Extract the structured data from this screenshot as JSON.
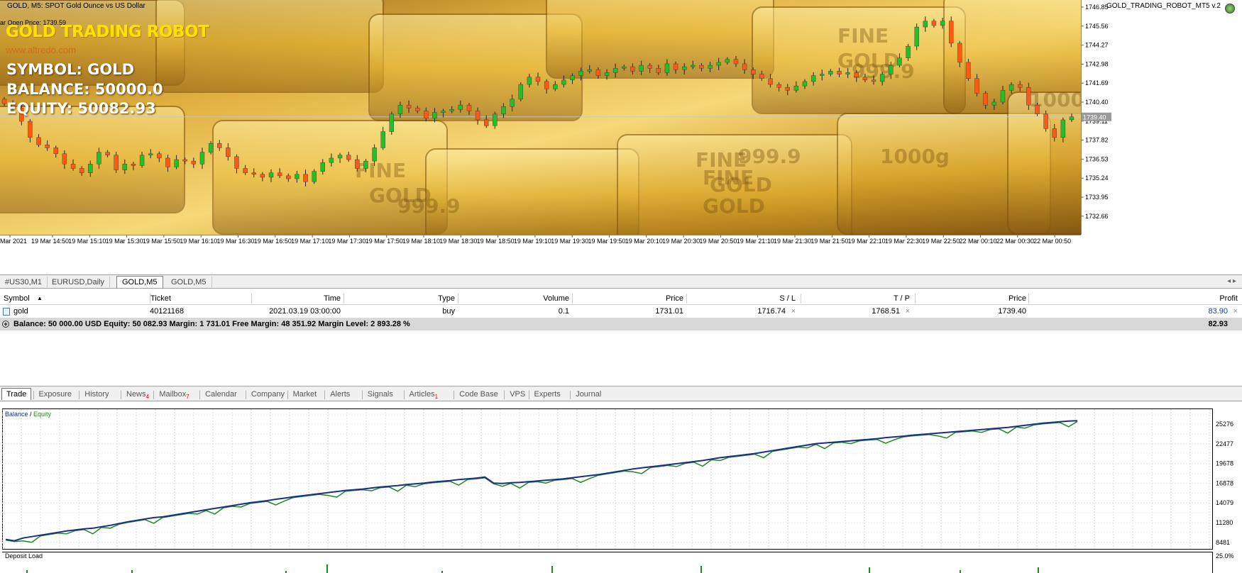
{
  "chart": {
    "title": "GOLD, M5:  SPOT Gold Ounce vs US Dollar",
    "open_price": "ar Open Price:  1739.59",
    "robot_name": "GOLD TRADING ROBOT",
    "website": "www.altredo.com",
    "symbol_line": "SYMBOL: GOLD",
    "balance_line": "BALANCE: 50000.0",
    "equity_line": "EQUITY: 50082.93",
    "ea_label": "GOLD_TRADING_ROBOT_MT5  v.2",
    "current_price": "1739.40",
    "price_ticks": [
      "1746.85",
      "1745.56",
      "1744.27",
      "1742.98",
      "1741.69",
      "1740.40",
      "1739.11",
      "1737.82",
      "1736.53",
      "1735.24",
      "1733.95",
      "1732.66"
    ],
    "time_ticks": [
      "Mar 2021",
      "19 Mar 14:50",
      "19 Mar 15:10",
      "19 Mar 15:30",
      "19 Mar 15:50",
      "19 Mar 16:10",
      "19 Mar 16:30",
      "19 Mar 16:50",
      "19 Mar 17:10",
      "19 Mar 17:30",
      "19 Mar 17:50",
      "19 Mar 18:10",
      "19 Mar 18:30",
      "19 Mar 18:50",
      "19 Mar 19:10",
      "19 Mar 19:30",
      "19 Mar 19:50",
      "19 Mar 20:10",
      "19 Mar 20:30",
      "19 Mar 20:50",
      "19 Mar 21:10",
      "19 Mar 21:30",
      "19 Mar 21:50",
      "19 Mar 22:10",
      "19 Mar 22:30",
      "19 Mar 22:50",
      "22 Mar 00:10",
      "22 Mar 00:30",
      "22 Mar 00:50"
    ],
    "bar_label_ghost": [
      "FINE",
      "GOLD",
      "999.9",
      "FINE",
      "GOLD",
      "999.9",
      "1000g",
      "FINE",
      "GOLD",
      "999.9",
      "FINE",
      "GOLD",
      "1000g"
    ]
  },
  "chart_tabs": [
    {
      "label": "#US30,M1",
      "active": false
    },
    {
      "label": "EURUSD,Daily",
      "active": false
    },
    {
      "label": "GOLD,M5",
      "active": true
    },
    {
      "label": "GOLD,M5",
      "active": false
    }
  ],
  "table": {
    "headers": [
      "Symbol",
      "Ticket",
      "Time",
      "Type",
      "Volume",
      "Price",
      "S / L",
      "T / P",
      "Price",
      "Profit"
    ],
    "row": {
      "symbol": "gold",
      "ticket": "40121168",
      "time": "2021.03.19 03:00:00",
      "type": "buy",
      "volume": "0.1",
      "price": "1731.01",
      "sl": "1716.74",
      "tp": "1768.51",
      "cur_price": "1739.40",
      "profit": "83.90"
    },
    "summary": "Balance: 50 000.00 USD  Equity: 50 082.93  Margin: 1 731.01  Free Margin: 48 351.92  Margin Level: 2 893.28 %",
    "summary_profit": "82.93"
  },
  "toolbox_tabs": [
    {
      "label": "Trade",
      "active": true,
      "badge": ""
    },
    {
      "label": "Exposure",
      "active": false,
      "badge": ""
    },
    {
      "label": "History",
      "active": false,
      "badge": ""
    },
    {
      "label": "News",
      "active": false,
      "badge": "4"
    },
    {
      "label": "Mailbox",
      "active": false,
      "badge": "7"
    },
    {
      "label": "Calendar",
      "active": false,
      "badge": ""
    },
    {
      "label": "Company",
      "active": false,
      "badge": ""
    },
    {
      "label": "Market",
      "active": false,
      "badge": ""
    },
    {
      "label": "Alerts",
      "active": false,
      "badge": ""
    },
    {
      "label": "Signals",
      "active": false,
      "badge": ""
    },
    {
      "label": "Articles",
      "active": false,
      "badge": "1"
    },
    {
      "label": "Code Base",
      "active": false,
      "badge": ""
    },
    {
      "label": "VPS",
      "active": false,
      "badge": ""
    },
    {
      "label": "Experts",
      "active": false,
      "badge": ""
    },
    {
      "label": "Journal",
      "active": false,
      "badge": ""
    }
  ],
  "equity_chart": {
    "legend_balance": "Balance",
    "legend_sep": " / ",
    "legend_equity": "Equity",
    "y_ticks": [
      "25276",
      "22477",
      "19678",
      "16878",
      "14079",
      "11280",
      "8481"
    ],
    "deposit_load_label": "Deposit Load",
    "deposit_load_tick": "25.0%"
  },
  "colors": {
    "bull": "#22c022",
    "bear": "#ff5a14",
    "balance": "#1a2f8a",
    "equity": "#1f8a1f",
    "gold_light": "#f3d36b",
    "gold_dark": "#6e4a0a"
  }
}
